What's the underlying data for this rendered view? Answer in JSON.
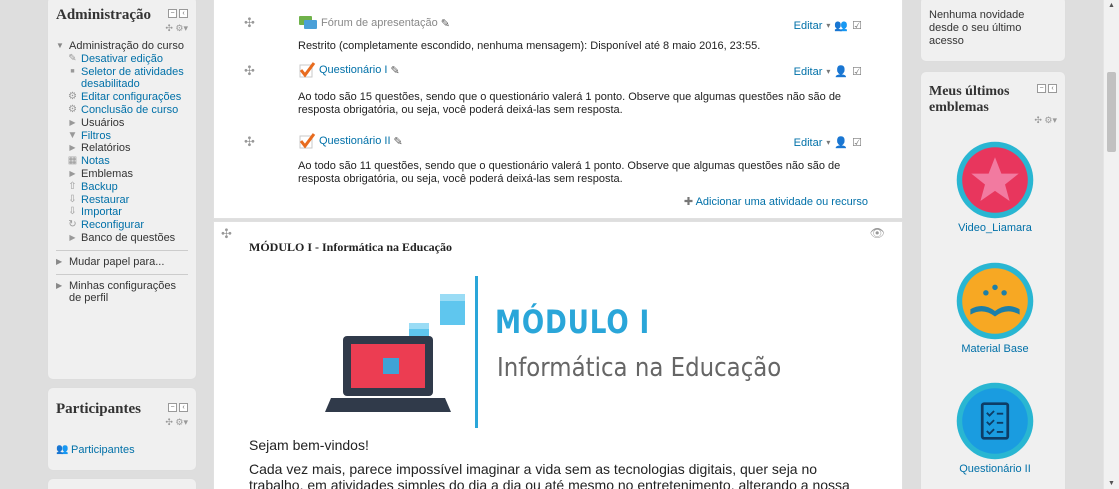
{
  "admin_block": {
    "title": "Administração",
    "course_admin": "Administração do curso",
    "items": [
      {
        "label": "Desativar edição",
        "icon": "pencil-icon"
      },
      {
        "label": "Seletor de atividades desabilitado",
        "icon": "bullet-icon"
      },
      {
        "label": "Editar configurações",
        "icon": "gear-icon"
      },
      {
        "label": "Conclusão de curso",
        "icon": "gear-icon"
      },
      {
        "label": "Usuários",
        "icon": "triangle-right-icon"
      },
      {
        "label": "Filtros",
        "icon": "filter-icon"
      },
      {
        "label": "Relatórios",
        "icon": "triangle-right-icon"
      },
      {
        "label": "Notas",
        "icon": "grades-icon"
      },
      {
        "label": "Emblemas",
        "icon": "triangle-right-icon"
      },
      {
        "label": "Backup",
        "icon": "upload-icon"
      },
      {
        "label": "Restaurar",
        "icon": "download-icon"
      },
      {
        "label": "Importar",
        "icon": "download-icon"
      },
      {
        "label": "Reconfigurar",
        "icon": "refresh-icon"
      },
      {
        "label": "Banco de questões",
        "icon": "triangle-right-icon"
      }
    ],
    "switch_role": "Mudar papel para...",
    "profile_settings": "Minhas configurações de perfil"
  },
  "participants_block": {
    "title": "Participantes",
    "link": "Participantes"
  },
  "activities": [
    {
      "name": "Fórum de apresentação",
      "icon": "forum-icon",
      "edit": "Editar",
      "desc": "Restrito (completamente escondido, nenhuma mensagem): Disponível até 8 maio 2016, 23:55."
    },
    {
      "name": "Questionário I",
      "icon": "quiz-icon",
      "edit": "Editar",
      "desc": "Ao todo são 15 questões, sendo que o questionário valerá 1 ponto. Observe que algumas questões não são de resposta obrigatória, ou seja, você poderá deixá-las sem resposta."
    },
    {
      "name": "Questionário II",
      "icon": "quiz-icon",
      "edit": "Editar",
      "desc": "Ao todo são 11 questões, sendo que o questionário valerá 1 ponto. Observe que algumas questões não são de resposta obrigatória, ou seja, você poderá deixá-las sem resposta."
    }
  ],
  "add_activity": "Adicionar uma atividade ou recurso",
  "module": {
    "title": "MÓDULO I - Informática na Educação",
    "banner_title": "MÓDULO I",
    "banner_subtitle": "Informática na Educação",
    "welcome": "Sejam bem-vindos!",
    "paragraph": "Cada vez mais, parece impossível imaginar a vida sem as tecnologias digitais, quer seja no trabalho, em atividades simples do dia a dia ou até mesmo no entretenimento, alterando a nossa forma de comunicar"
  },
  "news_block": {
    "text": "Nenhuma novidade desde o seu último acesso"
  },
  "badges_block": {
    "title": "Meus últimos emblemas",
    "badges": [
      {
        "name": "Video_Liamara",
        "color": "#e8365d",
        "icon": "star-icon"
      },
      {
        "name": "Material Base",
        "color": "#f7a823",
        "icon": "book-icon"
      },
      {
        "name": "Questionário II",
        "color": "#1a9ce0",
        "icon": "checklist-icon"
      }
    ]
  },
  "colors": {
    "link": "#0070a8",
    "banner_blue": "#2aa6d9",
    "badge_ring": "#29b6d2"
  }
}
